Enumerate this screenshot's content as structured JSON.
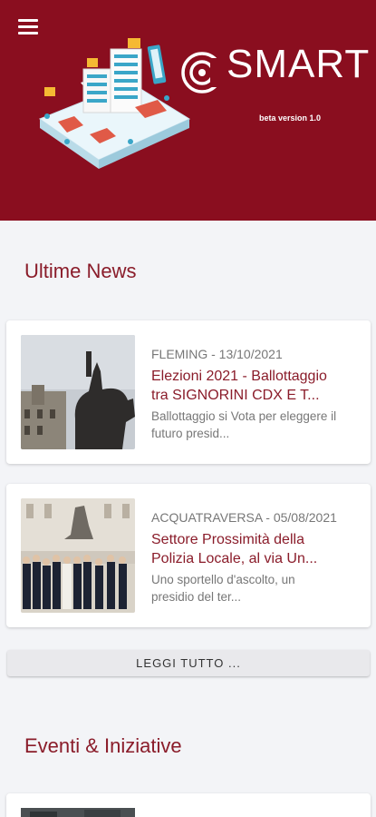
{
  "header": {
    "brand": "SMART",
    "version": "beta version 1.0",
    "menu_icon": "hamburger-menu-icon"
  },
  "news": {
    "section_title": "Ultime News",
    "items": [
      {
        "meta": "FLEMING - 13/10/2021",
        "title_line1": "Elezioni 2021 - Ballottaggio",
        "title_line2": "tra SIGNORINI CDX E T...",
        "excerpt_line1": "Ballottaggio si Vota per eleggere il",
        "excerpt_line2": "futuro presid..."
      },
      {
        "meta": "ACQUATRAVERSA - 05/08/2021",
        "title_line1": "Settore Prossimità della",
        "title_line2": "Polizia Locale, al via Un...",
        "excerpt_line1": "Uno sportello d'ascolto, un",
        "excerpt_line2": "presidio del ter..."
      }
    ],
    "read_more": "LEGGI TUTTO ..."
  },
  "events": {
    "section_title": "Eventi & Iniziative"
  },
  "colors": {
    "header_bg": "#8a0e1f",
    "accent_text": "#8a1c2a",
    "page_bg": "#f3f4f7"
  }
}
